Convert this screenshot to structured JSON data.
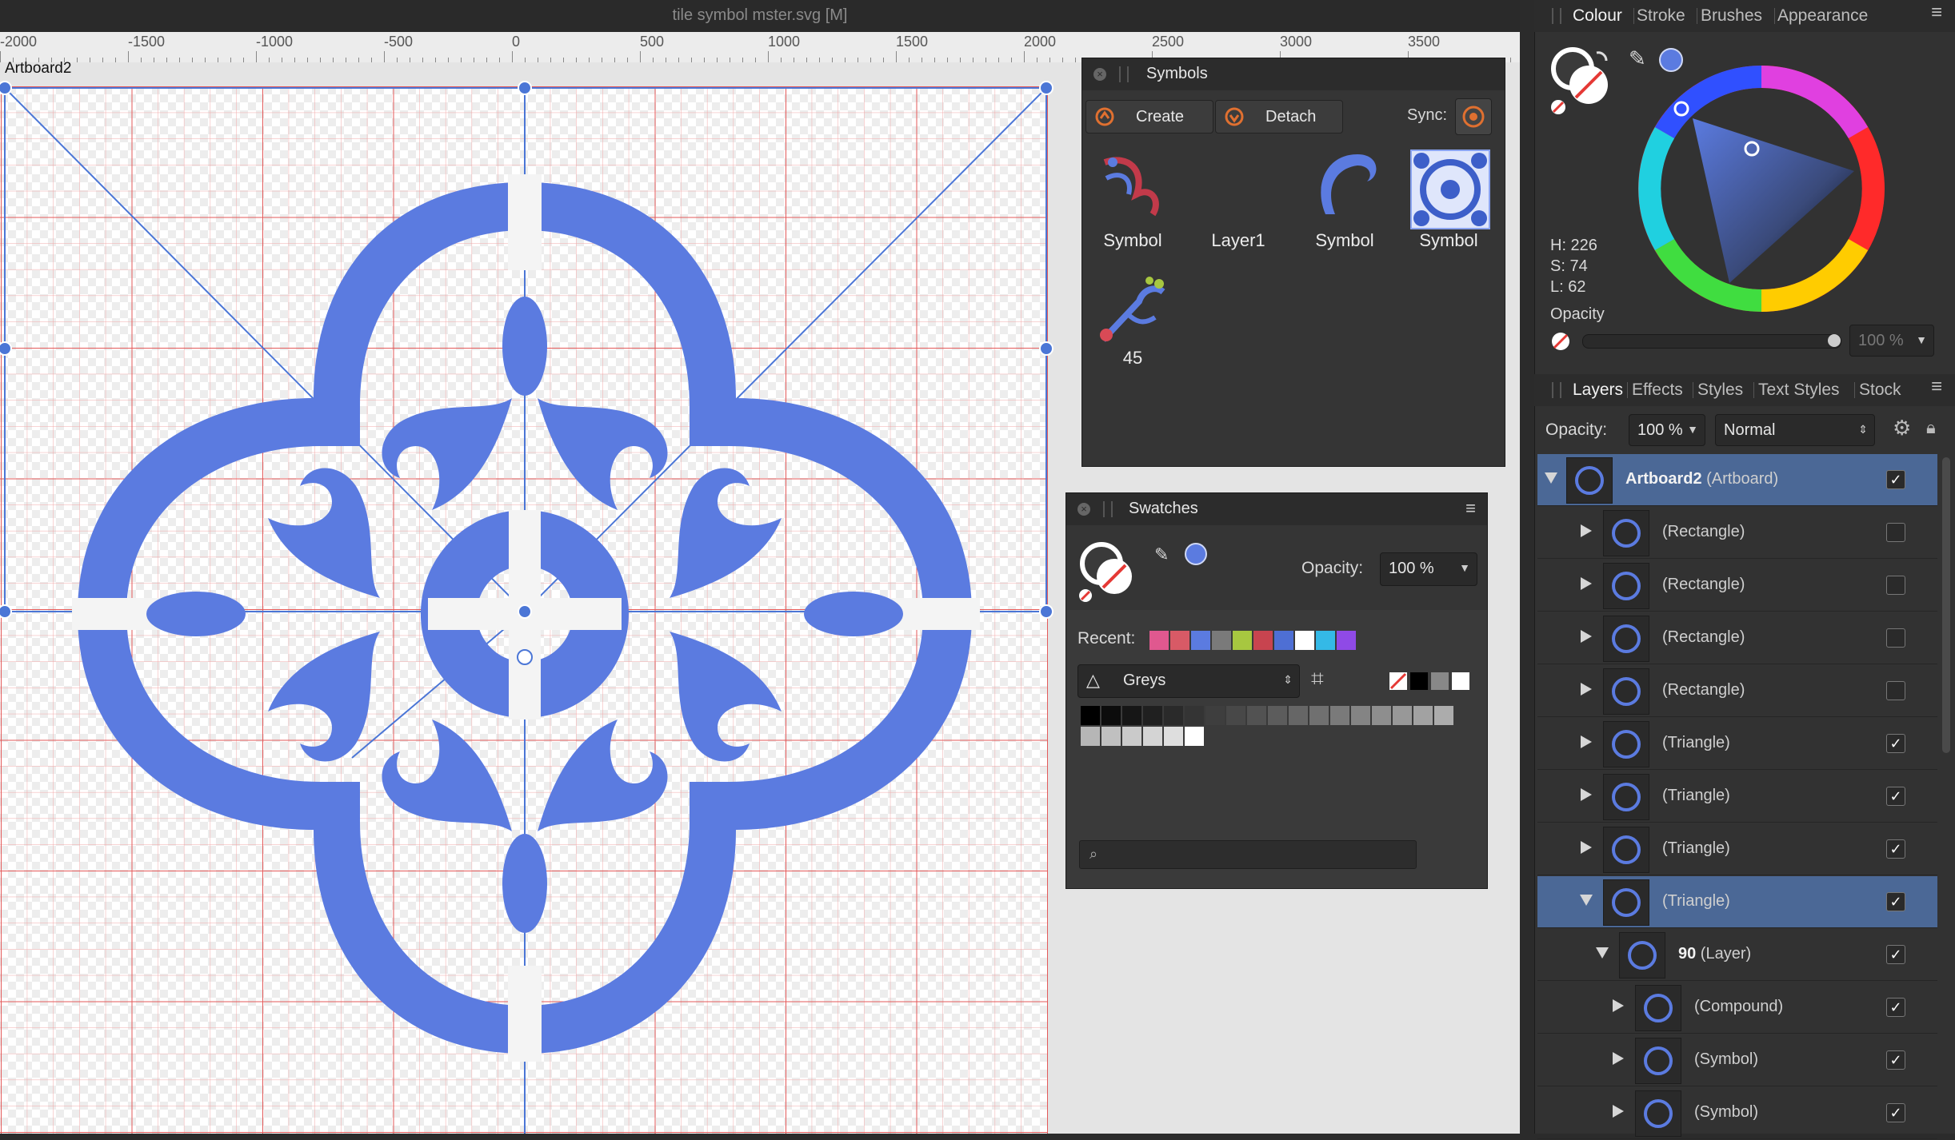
{
  "window": {
    "title": "tile symbol mster.svg [M]"
  },
  "ruler": {
    "labels": [
      "-2000",
      "-1500",
      "-1000",
      "-500",
      "0",
      "500",
      "1000",
      "1500",
      "2000",
      "2500",
      "3000",
      "3500"
    ]
  },
  "canvas": {
    "artboard_label": "Artboard2",
    "symbol_color": "#5b7be0"
  },
  "symbols_panel": {
    "title": "Symbols",
    "create_label": "Create",
    "detach_label": "Detach",
    "sync_label": "Sync:",
    "items": [
      {
        "label": "Symbol",
        "icon": "floral-corner-icon"
      },
      {
        "label": "Layer1",
        "icon": "empty-icon"
      },
      {
        "label": "Symbol",
        "icon": "crescent-hook-icon"
      },
      {
        "label": "Symbol",
        "icon": "tile-pattern-icon"
      },
      {
        "label": "45",
        "icon": "floral-branch-icon"
      }
    ]
  },
  "swatches_panel": {
    "title": "Swatches",
    "opacity_label": "Opacity:",
    "opacity_value": "100 %",
    "recent_label": "Recent:",
    "recent_colors": [
      "#e0588f",
      "#d85a66",
      "#5b7be0",
      "#7a7a7a",
      "#a7c740",
      "#c8444f",
      "#4e6fd4",
      "#ffffff",
      "#34b9e6",
      "#8f4ae6"
    ],
    "palette_name": "Greys",
    "search_placeholder": ""
  },
  "right_tabs_top": [
    "Colour",
    "Stroke",
    "Brushes",
    "Appearance"
  ],
  "colour": {
    "h": "H: 226",
    "s": "S: 74",
    "l": "L: 62",
    "opacity_label": "Opacity",
    "opacity_value": "100 %",
    "current_color": "#5b7be0"
  },
  "right_tabs_bottom": [
    "Layers",
    "Effects",
    "Styles",
    "Text Styles",
    "Stock"
  ],
  "layers": {
    "opacity_label": "Opacity:",
    "opacity_value": "100 %",
    "blend_mode": "Normal",
    "rows": [
      {
        "name": "Artboard2",
        "suffix": "(Artboard)",
        "checked": "✓"
      },
      {
        "name": "(Rectangle)",
        "checked": ""
      },
      {
        "name": "(Rectangle)",
        "checked": ""
      },
      {
        "name": "(Rectangle)",
        "checked": ""
      },
      {
        "name": "(Rectangle)",
        "checked": ""
      },
      {
        "name": "(Triangle)",
        "checked": "✓"
      },
      {
        "name": "(Triangle)",
        "checked": "✓"
      },
      {
        "name": "(Triangle)",
        "checked": "✓"
      },
      {
        "name": "(Triangle)",
        "checked": "✓"
      },
      {
        "name": "90",
        "suffix": "(Layer)",
        "checked": "✓"
      },
      {
        "name": "(Compound)",
        "checked": "✓"
      },
      {
        "name": "(Symbol)",
        "checked": "✓"
      },
      {
        "name": "(Symbol)",
        "checked": "✓"
      }
    ]
  }
}
